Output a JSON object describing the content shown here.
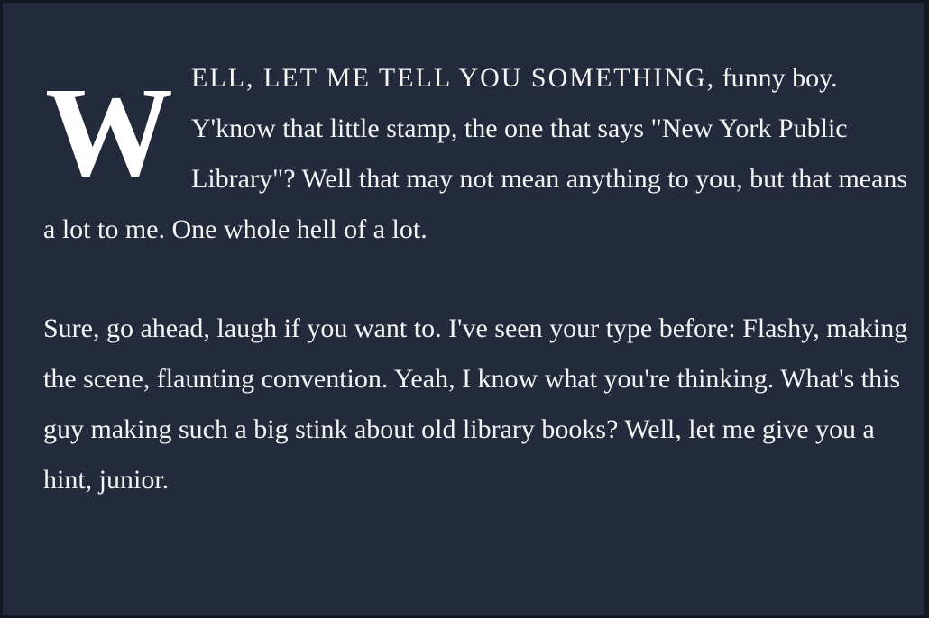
{
  "article": {
    "drop_cap": "W",
    "lead_in": "ELL, LET ME TELL YOU SOMETHING,",
    "paragraph1_rest": "funny boy. Y'know that little stamp, the one that says \"New York Public Library\"? Well that may not mean anything to you, but that means a lot to me. One whole hell of a lot.",
    "paragraph2": "Sure, go ahead, laugh if you want to. I've seen your type before: Flashy, making the scene, flaunting convention. Yeah, I know what you're thinking. What's this guy making such a big stink about old library books? Well, let me give you a hint, junior."
  },
  "colors": {
    "background": "#222a3b",
    "border": "#121722",
    "text": "#f4f4f4"
  }
}
